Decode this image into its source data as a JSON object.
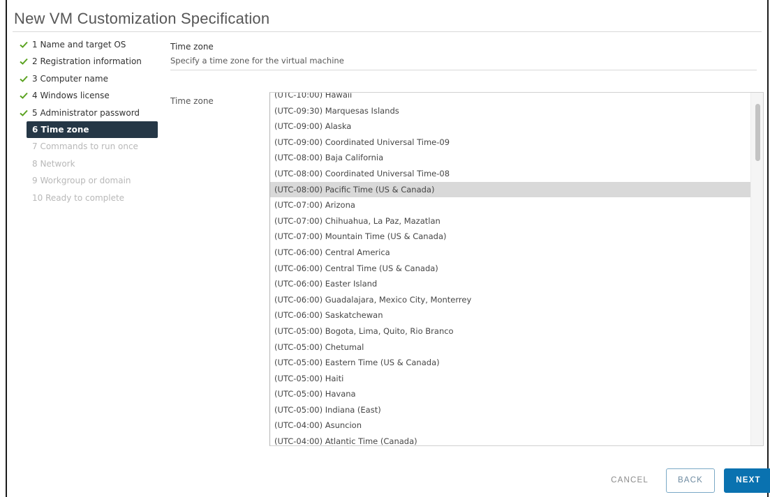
{
  "dialog": {
    "title": "New VM Customization Specification"
  },
  "steps": [
    {
      "label": "1 Name and target OS",
      "state": "done"
    },
    {
      "label": "2 Registration information",
      "state": "done"
    },
    {
      "label": "3 Computer name",
      "state": "done"
    },
    {
      "label": "4 Windows license",
      "state": "done"
    },
    {
      "label": "5 Administrator password",
      "state": "done"
    },
    {
      "label": "6 Time zone",
      "state": "active"
    },
    {
      "label": "7 Commands to run once",
      "state": "pending"
    },
    {
      "label": "8 Network",
      "state": "pending"
    },
    {
      "label": "9 Workgroup or domain",
      "state": "pending"
    },
    {
      "label": "10 Ready to complete",
      "state": "pending"
    }
  ],
  "section": {
    "title": "Time zone",
    "description": "Specify a time zone for the virtual machine"
  },
  "field": {
    "label": "Time zone",
    "selected": "(UTC-08:00) Pacific Time (US & Canada)",
    "options": [
      "(UTC-10:00) Hawaii",
      "(UTC-09:30) Marquesas Islands",
      "(UTC-09:00) Alaska",
      "(UTC-09:00) Coordinated Universal Time-09",
      "(UTC-08:00) Baja California",
      "(UTC-08:00) Coordinated Universal Time-08",
      "(UTC-08:00) Pacific Time (US & Canada)",
      "(UTC-07:00) Arizona",
      "(UTC-07:00) Chihuahua, La Paz, Mazatlan",
      "(UTC-07:00) Mountain Time (US & Canada)",
      "(UTC-06:00) Central America",
      "(UTC-06:00) Central Time (US & Canada)",
      "(UTC-06:00) Easter Island",
      "(UTC-06:00) Guadalajara, Mexico City, Monterrey",
      "(UTC-06:00) Saskatchewan",
      "(UTC-05:00) Bogota, Lima, Quito, Rio Branco",
      "(UTC-05:00) Chetumal",
      "(UTC-05:00) Eastern Time (US & Canada)",
      "(UTC-05:00) Haiti",
      "(UTC-05:00) Havana",
      "(UTC-05:00) Indiana (East)",
      "(UTC-04:00) Asuncion",
      "(UTC-04:00) Atlantic Time (Canada)"
    ]
  },
  "buttons": {
    "cancel": "CANCEL",
    "back": "BACK",
    "next": "NEXT"
  },
  "icons": {
    "done_step": "checkmark-icon"
  },
  "colors": {
    "active_step_bg": "#253746",
    "check": "#5aa220",
    "primary_button": "#0a72b0",
    "selected_option_bg": "#d9d9d9"
  }
}
